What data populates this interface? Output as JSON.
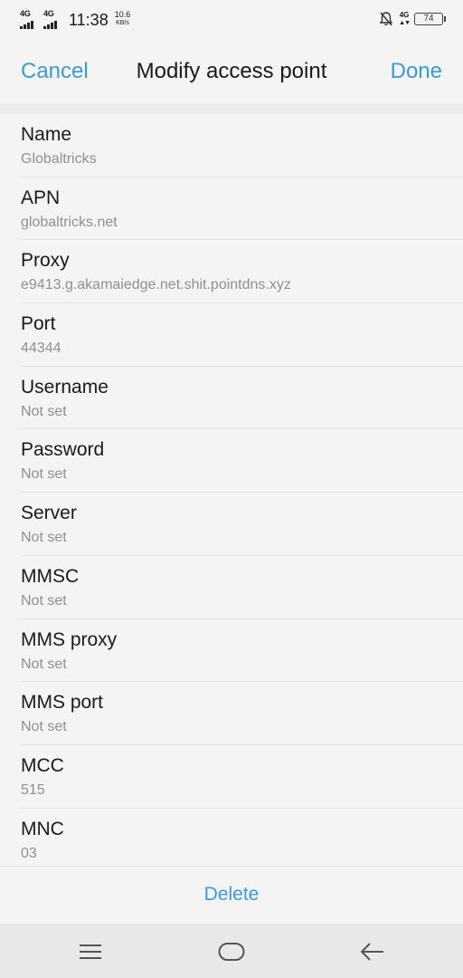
{
  "status_bar": {
    "sim1_network": "4G",
    "sim2_network": "4G",
    "time": "11:38",
    "speed_value": "10.6",
    "speed_unit": "KB/s",
    "right_network": "4G",
    "battery_level": "74"
  },
  "header": {
    "cancel_label": "Cancel",
    "title": "Modify access point",
    "done_label": "Done"
  },
  "settings": [
    {
      "label": "Name",
      "value": "Globaltricks"
    },
    {
      "label": "APN",
      "value": "globaltricks.net"
    },
    {
      "label": "Proxy",
      "value": "e9413.g.akamaiedge.net.shit.pointdns.xyz"
    },
    {
      "label": "Port",
      "value": "44344"
    },
    {
      "label": "Username",
      "value": "Not set"
    },
    {
      "label": "Password",
      "value": "Not set"
    },
    {
      "label": "Server",
      "value": "Not set"
    },
    {
      "label": "MMSC",
      "value": "Not set"
    },
    {
      "label": "MMS proxy",
      "value": "Not set"
    },
    {
      "label": "MMS port",
      "value": "Not set"
    },
    {
      "label": "MCC",
      "value": "515"
    },
    {
      "label": "MNC",
      "value": "03"
    }
  ],
  "footer": {
    "delete_label": "Delete"
  },
  "colors": {
    "accent": "#3b9ad9",
    "background": "#f4f4f4",
    "secondary_text": "#8f8f8f"
  },
  "icons": {
    "notification_off": "bell-off-icon",
    "menu": "menu-icon",
    "home": "home-icon",
    "back": "back-arrow-icon"
  }
}
